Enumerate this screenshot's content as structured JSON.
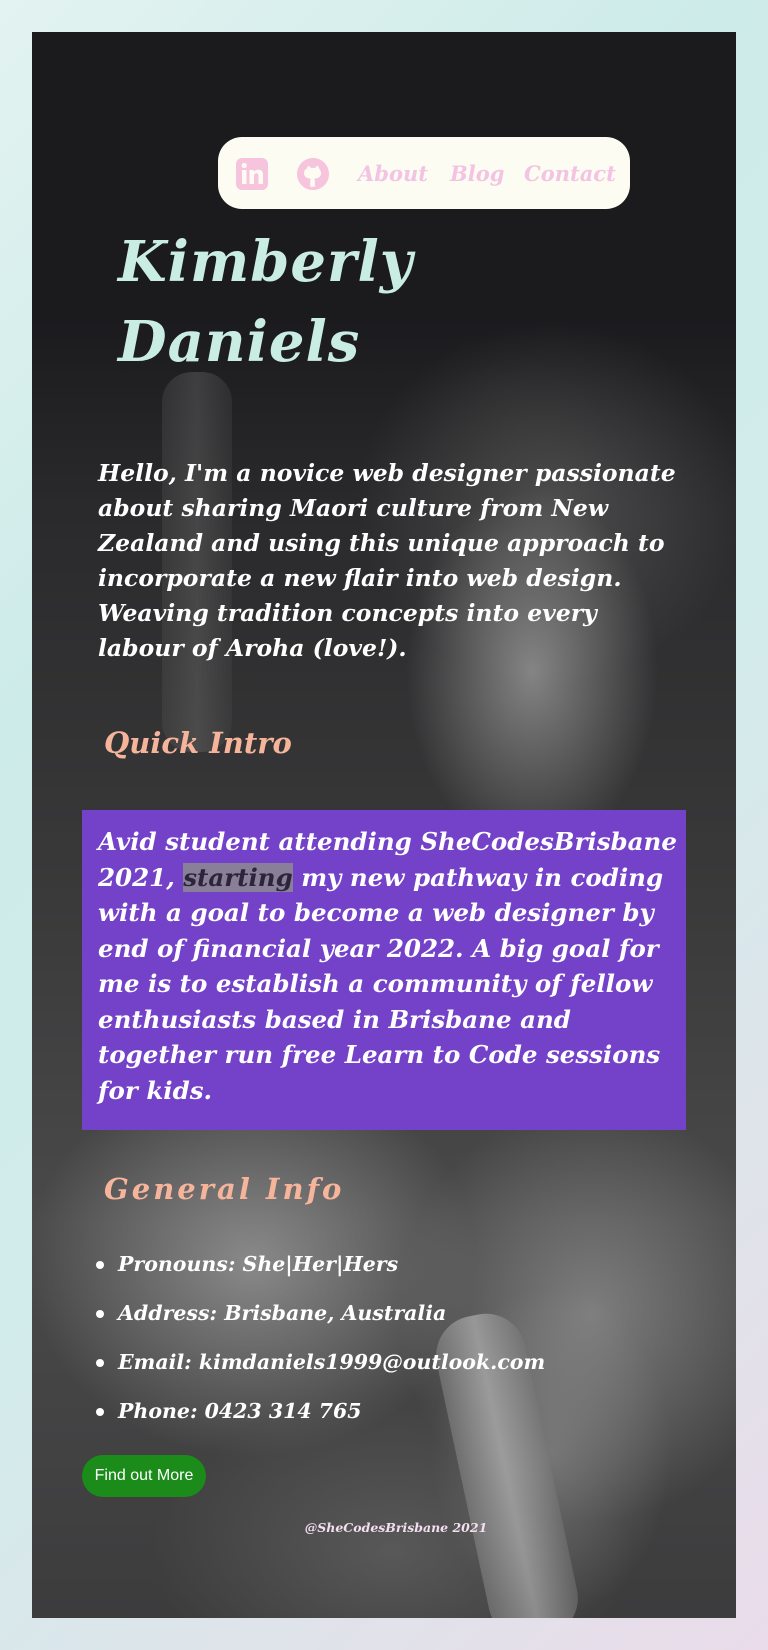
{
  "nav": {
    "icons": [
      "linkedin-icon",
      "github-icon"
    ],
    "links": [
      {
        "label": "About"
      },
      {
        "label": "Blog"
      },
      {
        "label": "Contact"
      }
    ],
    "background": "#fdfcf3",
    "link_color": "#f3c3e3"
  },
  "hero": {
    "name_line1": "Kimberly",
    "name_line2": "Daniels",
    "intro": "Hello, I'm a novice web designer passionate about sharing Maori culture from New Zealand and using this unique approach to incorporate a new flair into web design. Weaving tradition concepts into every labour of Aroha (love!)."
  },
  "quick_intro": {
    "heading": "Quick Intro",
    "text_before": "Avid student attending SheCodesBrisbane 2021, ",
    "highlighted": "starting",
    "text_after": " my new pathway in coding with a goal to become a web designer by end of financial year 2022. A big goal for me is to establish a community of fellow enthusiasts based in Brisbane and together run free Learn to Code sessions for kids.",
    "box_color": "#7342c9"
  },
  "general_info": {
    "heading": "General Info",
    "items": [
      "Pronouns: She|Her|Hers",
      "Address: Brisbane, Australia",
      "Email: kimdaniels1999@outlook.com",
      "Phone: 0423 314 765"
    ]
  },
  "cta": {
    "label": "Find out More",
    "color": "#1b8b1a"
  },
  "footer": {
    "text": "@SheCodesBrisbane 2021"
  },
  "colors": {
    "name": "#c9ece3",
    "headings": "#f6b49b"
  }
}
